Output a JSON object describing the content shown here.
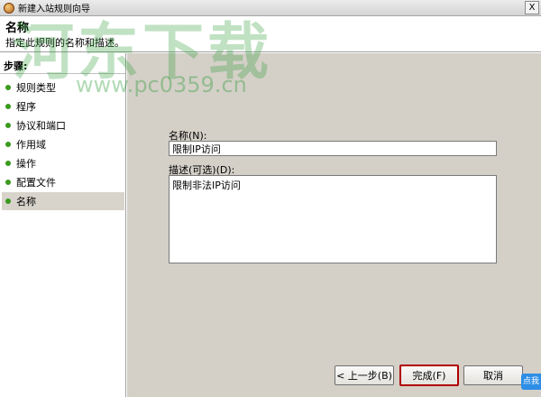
{
  "window": {
    "title": "新建入站规则向导",
    "close_glyph": "X"
  },
  "header": {
    "title": "名称",
    "description": "指定此规则的名称和描述。"
  },
  "steps": {
    "label": "步骤:",
    "items": [
      {
        "label": "规则类型"
      },
      {
        "label": "程序"
      },
      {
        "label": "协议和端口"
      },
      {
        "label": "作用域"
      },
      {
        "label": "操作"
      },
      {
        "label": "配置文件"
      },
      {
        "label": "名称",
        "active": true
      }
    ]
  },
  "form": {
    "name_label": "名称(N):",
    "name_value": "限制IP访问",
    "desc_label": "描述(可选)(D):",
    "desc_value": "限制非法IP访问"
  },
  "buttons": {
    "back": "< 上一步(B)",
    "finish": "完成(F)",
    "cancel": "取消"
  },
  "watermark": {
    "text": "河东下载",
    "url": "www.pc0359.cn"
  },
  "corner_badge": "点我",
  "colors": {
    "step_dot": "#3a9a1e",
    "main_background": "#d4d0c8",
    "default_button_border": "#b00000",
    "active_step": "#d8d4cc"
  }
}
